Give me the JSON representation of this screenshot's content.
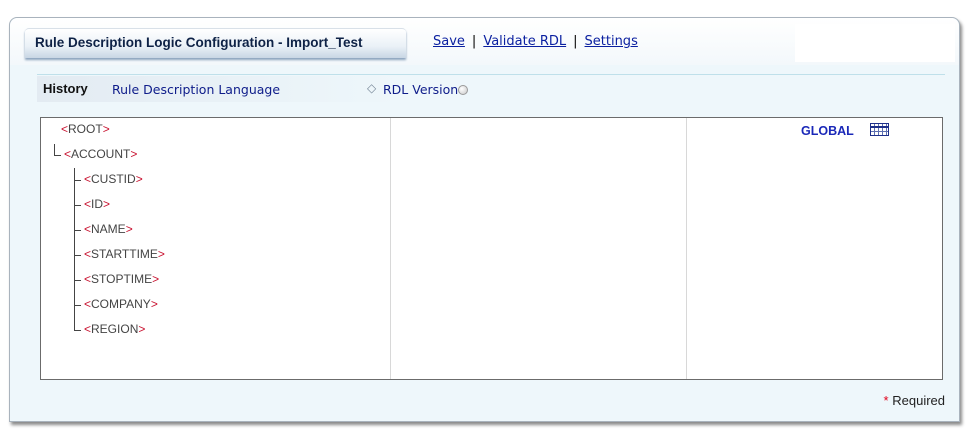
{
  "header": {
    "title": "Rule Description Logic Configuration - Import_Test",
    "actions": {
      "save": "Save",
      "validate": "Validate RDL",
      "settings": "Settings"
    },
    "separator": "|"
  },
  "subtabs": {
    "history": "History",
    "rdl_language": "Rule Description Language",
    "rdl_version": "RDL Version",
    "diamond": "◇"
  },
  "tree": {
    "root": {
      "lt": "<",
      "name": "ROOT",
      "gt": ">"
    },
    "account": {
      "lt": "<",
      "name": "ACCOUNT",
      "gt": ">"
    },
    "children": [
      {
        "lt": "<",
        "name": "CUSTID",
        "gt": ">"
      },
      {
        "lt": "<",
        "name": "ID",
        "gt": ">"
      },
      {
        "lt": "<",
        "name": "NAME",
        "gt": ">"
      },
      {
        "lt": "<",
        "name": "STARTTIME",
        "gt": ">"
      },
      {
        "lt": "<",
        "name": "STOPTIME",
        "gt": ">"
      },
      {
        "lt": "<",
        "name": "COMPANY",
        "gt": ">"
      },
      {
        "lt": "<",
        "name": "REGION",
        "gt": ">"
      }
    ]
  },
  "scope": {
    "label": "GLOBAL",
    "icon": "grid-table-icon"
  },
  "footer": {
    "star": "*",
    "required": "Required"
  },
  "colors": {
    "accent_link": "#0a1fa0",
    "tag_bracket": "#c8102e",
    "global": "#1a28b8"
  }
}
